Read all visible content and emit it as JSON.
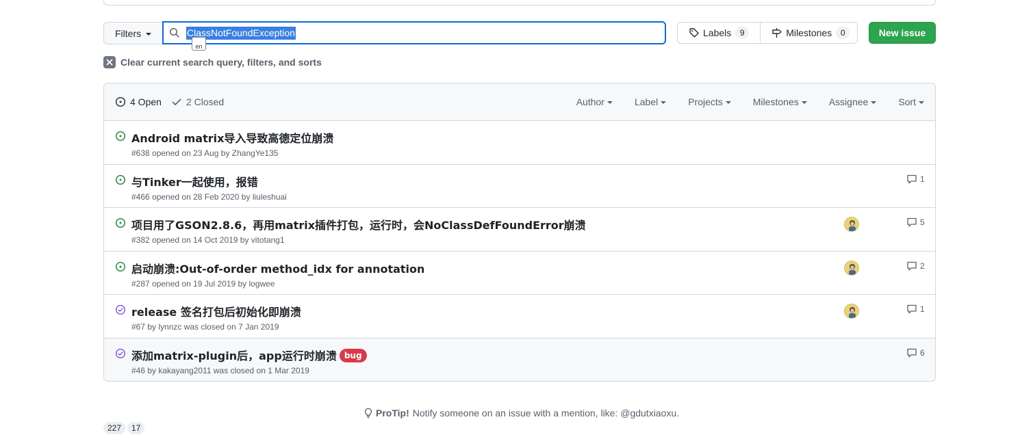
{
  "toolbar": {
    "filters_label": "Filters",
    "search_value": "ClassNotFoundException",
    "ime_indicator": "en",
    "labels_label": "Labels",
    "labels_count": "9",
    "milestones_label": "Milestones",
    "milestones_count": "0",
    "new_issue_label": "New issue"
  },
  "clear_query": {
    "label": "Clear current search query, filters, and sorts"
  },
  "issues_header": {
    "open_label": "4 Open",
    "closed_label": "2 Closed",
    "filters": [
      "Author",
      "Label",
      "Projects",
      "Milestones",
      "Assignee",
      "Sort"
    ]
  },
  "issues": [
    {
      "state": "open",
      "title": "Android matrix导入导致高德定位崩溃",
      "meta": "#638 opened on 23 Aug by ZhangYe135",
      "label": "",
      "has_avatar": false,
      "comments": ""
    },
    {
      "state": "open",
      "title": "与Tinker一起使用，报错",
      "meta": "#466 opened on 28 Feb 2020 by liuleshuai",
      "label": "",
      "has_avatar": false,
      "comments": "1"
    },
    {
      "state": "open",
      "title": "项目用了GSON2.8.6，再用matrix插件打包，运行时，会NoClassDefFoundError崩溃",
      "meta": "#382 opened on 14 Oct 2019 by vitotang1",
      "label": "",
      "has_avatar": true,
      "comments": "5"
    },
    {
      "state": "open",
      "title": "启动崩溃:Out-of-order method_idx for annotation",
      "meta": "#287 opened on 19 Jul 2019 by logwee",
      "label": "",
      "has_avatar": true,
      "comments": "2"
    },
    {
      "state": "closed",
      "title": "release 签名打包后初始化即崩溃",
      "meta": "#67 by lynnzc was closed on 7 Jan 2019",
      "label": "",
      "has_avatar": true,
      "comments": "1"
    },
    {
      "state": "closed",
      "title": "添加matrix-plugin后，app运行时崩溃",
      "meta": "#46 by kakayang2011 was closed on 1 Mar 2019",
      "label": "bug",
      "has_avatar": false,
      "comments": "6"
    }
  ],
  "protip": {
    "label": "ProTip!",
    "text": "Notify someone on an issue with a mention, like: @gdutxiaoxu."
  },
  "pager": [
    "227",
    "17"
  ],
  "colors": {
    "open": "#1a7f37",
    "closed": "#8250df",
    "primary_button": "#2da44e",
    "bug_label": "#d73a4a",
    "search_focus": "#0969da"
  }
}
